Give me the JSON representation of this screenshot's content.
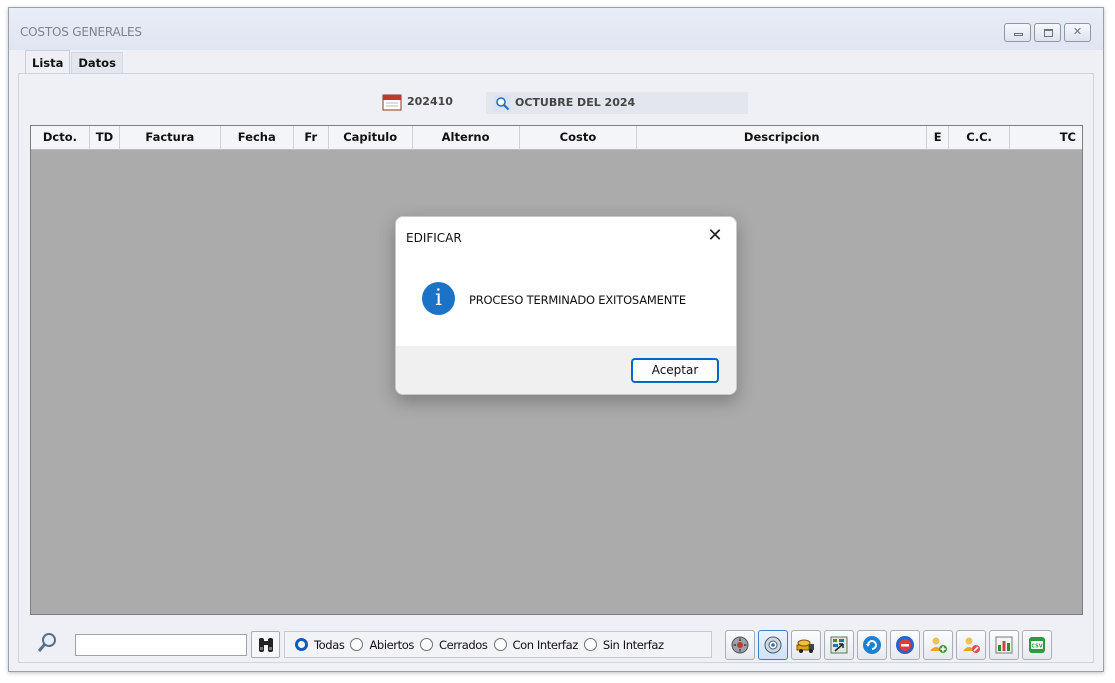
{
  "window": {
    "title": "COSTOS GENERALES"
  },
  "tabs": [
    "Lista",
    "Datos"
  ],
  "period": {
    "code": "202410",
    "name": "OCTUBRE DEL 2024"
  },
  "grid": {
    "columns": [
      "Dcto.",
      "TD",
      "Factura",
      "Fecha",
      "Fr",
      "Capitulo",
      "Alterno",
      "Costo",
      "Descripcion",
      "E",
      "C.C.",
      "TC"
    ],
    "rows": []
  },
  "dialog": {
    "title": "EDIFICAR",
    "message": "PROCESO TERMINADO EXITOSAMENTE",
    "ok_label": "Aceptar",
    "icon": "info-icon",
    "close_glyph": "✕"
  },
  "filters": {
    "search_value": "",
    "options": [
      "Todas",
      "Abiertos",
      "Cerrados",
      "Con Interfaz",
      "Sin Interfaz"
    ],
    "selected": "Todas"
  },
  "toolbar": {
    "icons": [
      "edificar-logo-icon",
      "edificar-settings-icon",
      "cement-truck-icon",
      "import-data-icon",
      "refresh-icon",
      "cancel-icon",
      "add-user-icon",
      "edit-user-icon",
      "chart-icon",
      "csv-export-icon"
    ]
  },
  "colors": {
    "grid_background": "#ababab",
    "accent": "#0066cc",
    "info_icon": "#1a73c7"
  }
}
